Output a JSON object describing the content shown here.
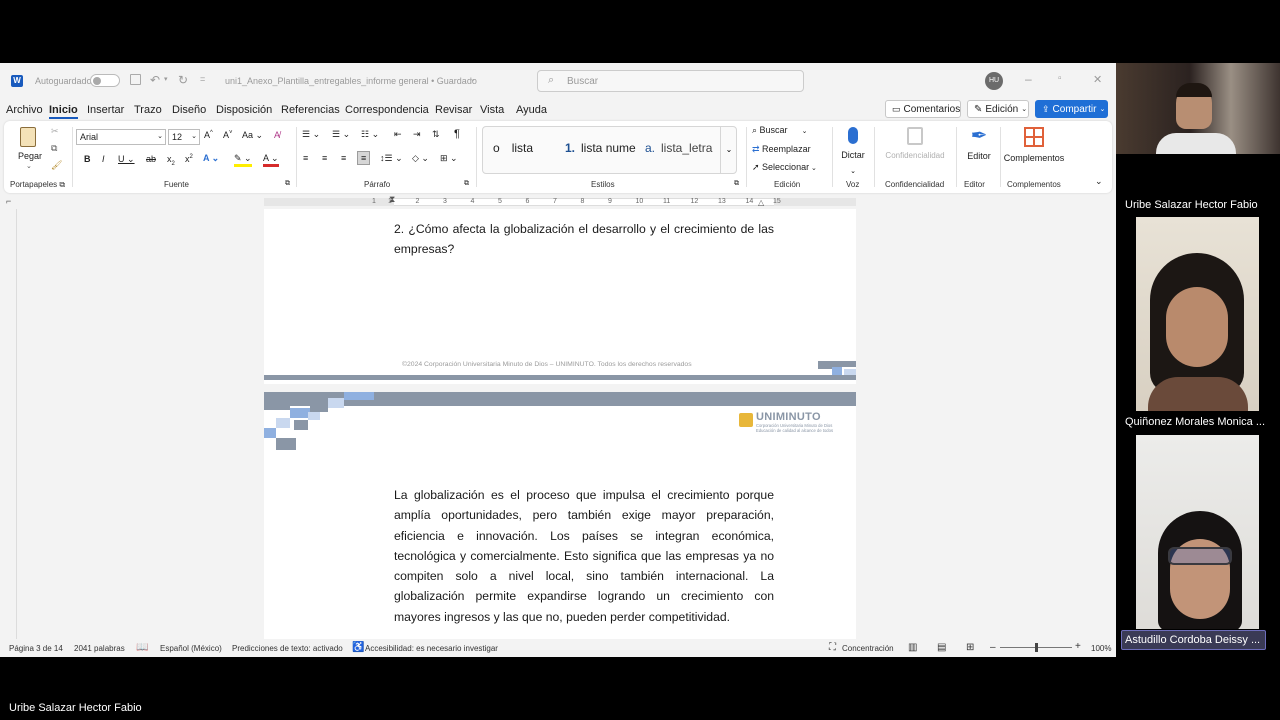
{
  "app": {
    "autosave_label": "Autoguardado",
    "doc_title": "uni1_Anexo_Plantilla_entregables_informe general • Guardado",
    "search_placeholder": "Buscar",
    "user_initials": "HU"
  },
  "menu": {
    "tabs": [
      "Archivo",
      "Inicio",
      "Insertar",
      "Trazo",
      "Diseño",
      "Disposición",
      "Referencias",
      "Correspondencia",
      "Revisar",
      "Vista",
      "Ayuda"
    ],
    "comments_label": "Comentarios",
    "editing_label": "Edición",
    "share_label": "Compartir"
  },
  "ribbon": {
    "paste_label": "Pegar",
    "font_name": "Arial",
    "font_size": "12",
    "styles": [
      {
        "marker": "o",
        "name": "lista"
      },
      {
        "marker": "1.",
        "name": "lista nume"
      },
      {
        "marker": "a.",
        "name": "lista_letra"
      }
    ],
    "find_label": "Buscar",
    "replace_label": "Reemplazar",
    "select_label": "Seleccionar",
    "dictate_label": "Dictar",
    "sensitivity_label": "Confidencialidad",
    "editor_label": "Editor",
    "addins_label": "Complementos",
    "groups": {
      "clipboard": "Portapapeles",
      "font": "Fuente",
      "paragraph": "Párrafo",
      "styles": "Estilos",
      "editing": "Edición",
      "voice": "Voz",
      "sensitivity": "Confidencialidad",
      "editor": "Editor",
      "addins": "Complementos"
    }
  },
  "ruler_ticks": [
    "1",
    "1",
    "2",
    "3",
    "4",
    "5",
    "6",
    "7",
    "8",
    "9",
    "10",
    "11",
    "12",
    "13",
    "14",
    "15"
  ],
  "document": {
    "question": "2. ¿Cómo afecta la globalización el desarrollo y el crecimiento de las empresas?",
    "footer": "©2024 Corporación Universitaria Minuto de Dios – UNIMINUTO. Todos los derechos reservados",
    "logo_name": "UNIMINUTO",
    "logo_line1": "Corporación Universitaria Minuto de Dios",
    "logo_line2": "Educación de calidad al alcance de todos",
    "answer": "La globalización es el proceso que impulsa el crecimiento porque amplía oportunidades, pero también exige mayor preparación, eficiencia e innovación. Los países se integran económica, tecnológica y comercialmente. Esto significa que las empresas ya no compiten solo a nivel local, sino también internacional. La globalización permite expandirse logrando un crecimiento con mayores ingresos y las que no, pueden perder competitividad."
  },
  "status": {
    "page": "Página 3 de 14",
    "words": "2041 palabras",
    "language": "Español (México)",
    "predictions": "Predicciones de texto: activado",
    "accessibility": "Accesibilidad: es necesario investigar",
    "focus": "Concentración",
    "zoom": "100%",
    "zoom_fraction": 0.5
  },
  "participants": [
    {
      "name": "Uribe Salazar Hector Fabio"
    },
    {
      "name": "Quiñonez Morales Monica ..."
    },
    {
      "name": "Astudillo Cordoba Deissy ..."
    }
  ],
  "presenter_name": "Uribe Salazar Hector Fabio",
  "colors": {
    "accent": "#185abd",
    "share": "#1f6fd6",
    "uniminuto_gray": "#8a96a6",
    "uniminuto_blue": "#8fb0e0"
  }
}
